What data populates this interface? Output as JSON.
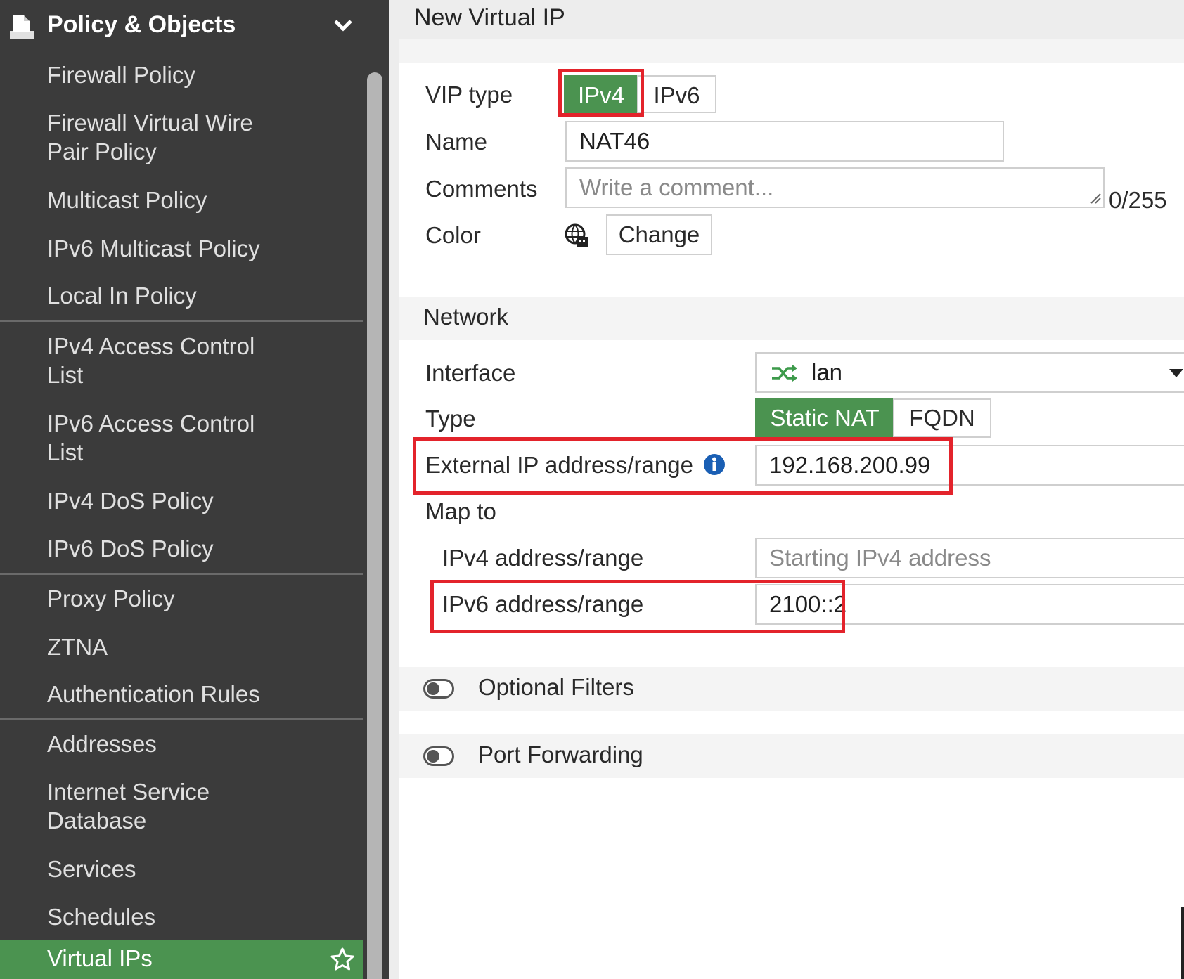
{
  "sidebar": {
    "header": {
      "title": "Policy & Objects"
    },
    "items": [
      {
        "label": "Firewall Policy"
      },
      {
        "label": "Firewall Virtual Wire Pair Policy"
      },
      {
        "label": "Multicast Policy"
      },
      {
        "label": "IPv6 Multicast Policy"
      },
      {
        "label": "Local In Policy"
      },
      {
        "label": "IPv4 Access Control List"
      },
      {
        "label": "IPv6 Access Control List"
      },
      {
        "label": "IPv4 DoS Policy"
      },
      {
        "label": "IPv6 DoS Policy"
      },
      {
        "label": "Proxy Policy"
      },
      {
        "label": "ZTNA"
      },
      {
        "label": "Authentication Rules"
      },
      {
        "label": "Addresses"
      },
      {
        "label": "Internet Service Database"
      },
      {
        "label": "Services"
      },
      {
        "label": "Schedules"
      },
      {
        "label": "Virtual IPs",
        "active": true
      }
    ]
  },
  "page": {
    "title": "New Virtual IP"
  },
  "form": {
    "vip_type": {
      "label": "VIP type",
      "options": [
        "IPv4",
        "IPv6"
      ],
      "selected": "IPv4"
    },
    "name": {
      "label": "Name",
      "value": "NAT46"
    },
    "comments": {
      "label": "Comments",
      "placeholder": "Write a comment...",
      "counter": "0/255"
    },
    "color": {
      "label": "Color",
      "button": "Change"
    }
  },
  "network": {
    "title": "Network",
    "interface": {
      "label": "Interface",
      "value": "lan"
    },
    "type": {
      "label": "Type",
      "options": [
        "Static NAT",
        "FQDN"
      ],
      "selected": "Static NAT"
    },
    "external_ip": {
      "label": "External IP address/range",
      "value": "192.168.200.99"
    },
    "map_to": {
      "label": "Map to"
    },
    "ipv4_range": {
      "label": "IPv4 address/range",
      "placeholder": "Starting IPv4 address"
    },
    "ipv6_range": {
      "label": "IPv6 address/range",
      "value": "2100::2"
    }
  },
  "optional_filters": {
    "label": "Optional Filters",
    "enabled": false
  },
  "port_forwarding": {
    "label": "Port Forwarding",
    "enabled": false
  },
  "colors": {
    "accent": "#4b9350",
    "sidebar_bg": "#3b3b3b",
    "highlight": "#e3232b",
    "info": "#1a5fb4"
  }
}
